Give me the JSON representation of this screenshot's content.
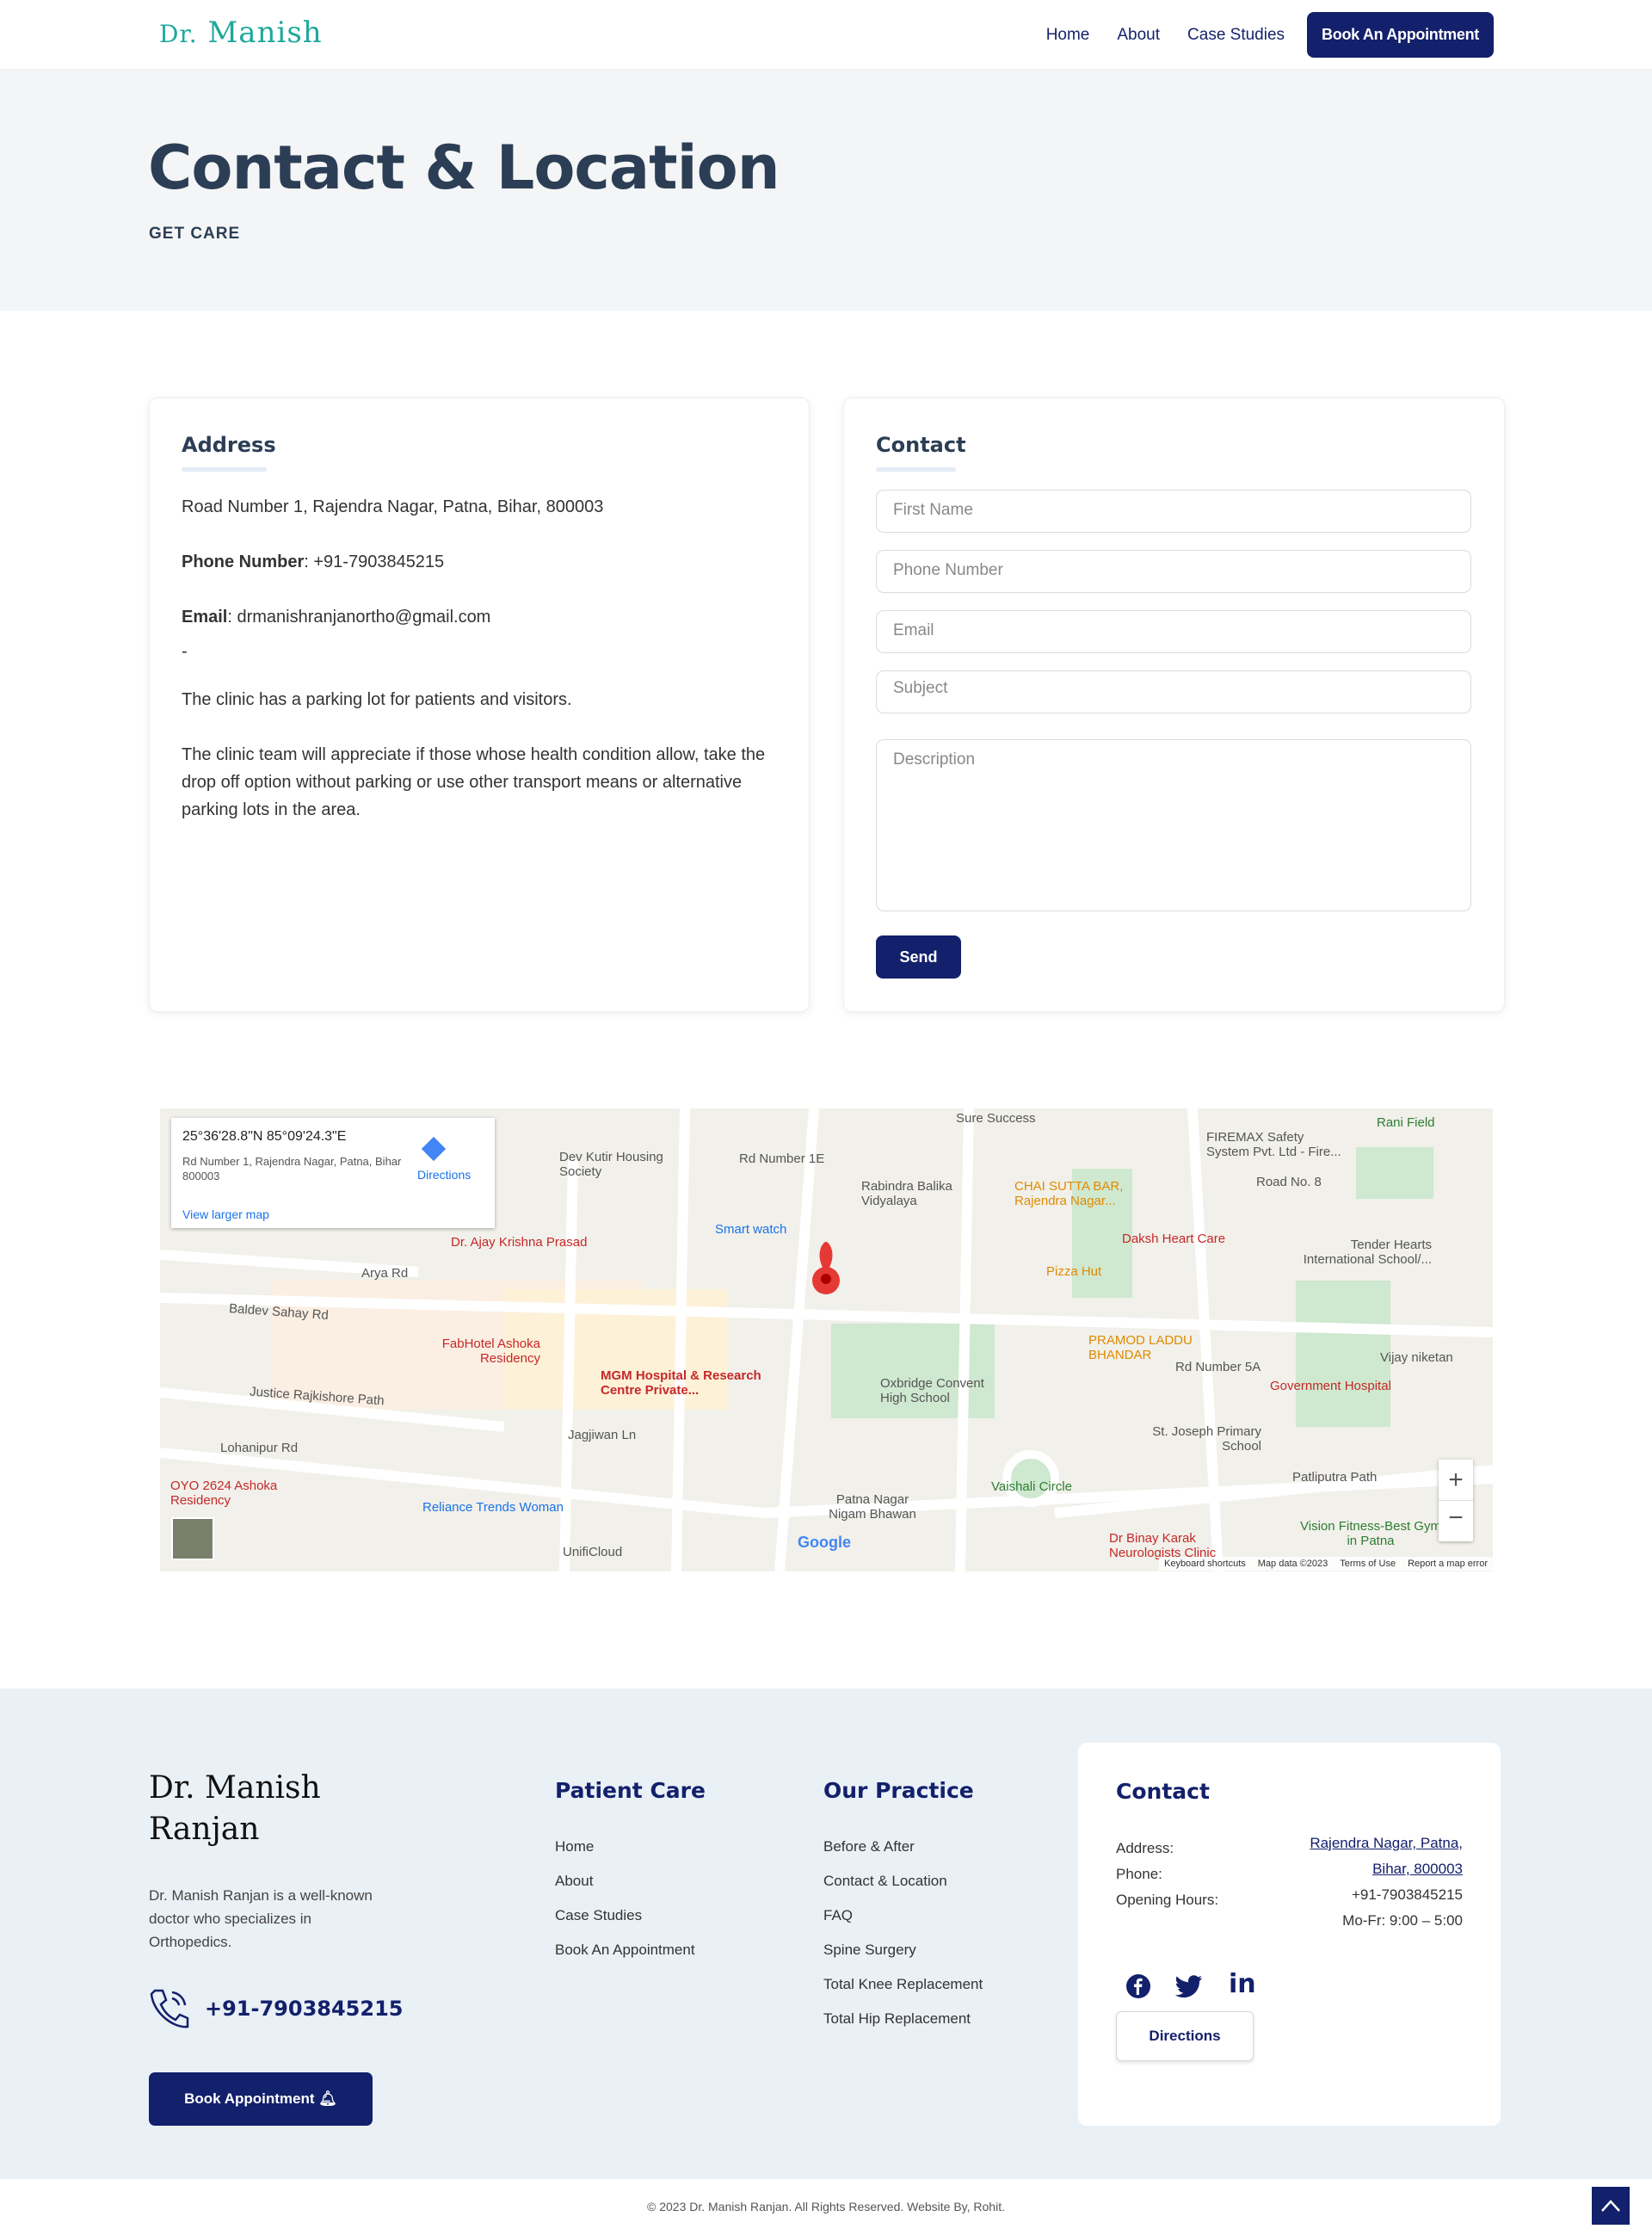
{
  "header": {
    "logo_prefix": "Dr.",
    "logo_name": "Manish",
    "nav": [
      {
        "label": "Home"
      },
      {
        "label": "About"
      },
      {
        "label": "Case Studies"
      }
    ],
    "book_label": "Book An Appointment"
  },
  "hero": {
    "title": "Contact & Location",
    "subtitle": "GET CARE"
  },
  "address_card": {
    "heading": "Address",
    "address": "Road Number 1, Rajendra Nagar, Patna, Bihar, 800003",
    "phone_label": "Phone Number",
    "phone": ": +91-7903845215",
    "email_label": "Email",
    "email": ": drmanishranjanortho@gmail.com",
    "dash": "-",
    "parking": "The clinic has a parking lot for patients and visitors.",
    "note": "The clinic team will appreciate if those whose health condition allow, take the drop off option without parking or use other transport means or alternative parking lots in the area."
  },
  "contact_card": {
    "heading": "Contact",
    "first_name": "First Name",
    "phone": "Phone Number",
    "email": "Email",
    "subject": "Subject",
    "description": "Description",
    "send": "Send"
  },
  "map": {
    "coords": "25°36'28.8\"N 85°09'24.3\"E",
    "address": "Rd Number 1, Rajendra Nagar, Patna, Bihar 800003",
    "directions": "Directions",
    "larger": "View larger map",
    "labels": [
      "Dr. Ajay Krishna Prasad",
      "FabHotel Ashoka Residency",
      "MGM Hospital & Research Centre Private...",
      "Smart watch",
      "Dev Kutir Housing Society",
      "Rabindra Balika Vidyalaya",
      "CHAI SUTTA BAR, Rajendra Nagar...",
      "Daksh Heart Care",
      "Pizza Hut",
      "PRAMOD LADDU BHANDAR",
      "Oxbridge Convent High School",
      "Government Hospital",
      "St. Joseph Primary School",
      "Vaishali Circle",
      "Reliance Trends Woman",
      "OYO 2624 Ashoka Residency",
      "Patna Nagar Nigam Bhawan",
      "Dr Binay Karak Neurologists Clinic",
      "Vision Fitness-Best Gym in Patna",
      "Tender Hearts International School/...",
      "Vijay niketan",
      "FIREMAX Safety System Pvt. Ltd - Fire...",
      "Rani Field",
      "Baldev Sahay Rd",
      "Arya Rd",
      "Justice Rajkishore Path",
      "Lohanipur Rd",
      "Jagjiwan Ln",
      "Patliputra Path",
      "UnifiCloud",
      "Sure Success",
      "Rd Number 1E",
      "Rd Number 5A",
      "Road No. 8"
    ],
    "footer": [
      "Keyboard shortcuts",
      "Map data ©2023",
      "Terms of Use",
      "Report a map error"
    ],
    "google": "Google"
  },
  "footer": {
    "brand1": "Dr. Manish",
    "brand2": "Ranjan",
    "about": "Dr. Manish Ranjan is a well-known doctor who specializes in Orthopedics.",
    "phone": "+91-7903845215",
    "book": "Book Appointment",
    "patient_care": {
      "heading": "Patient Care",
      "links": [
        "Home",
        "About",
        "Case Studies",
        "Book An Appointment"
      ]
    },
    "practice": {
      "heading": "Our Practice",
      "links": [
        "Before & After",
        "Contact & Location",
        "FAQ",
        "Spine Surgery",
        "Total Knee Replacement",
        "Total Hip Replacement"
      ]
    },
    "contact": {
      "heading": "Contact",
      "address_label": "Address:",
      "phone_label": "Phone:",
      "hours_label": "Opening Hours:",
      "address_line1": "Rajendra Nagar, Patna,",
      "address_line2": "Bihar, 800003",
      "phone": "+91-7903845215",
      "hours": "Mo-Fr: 9:00 – 5:00",
      "directions": "Directions"
    }
  },
  "copyright": "© 2023 Dr. Manish Ranjan. All Rights Reserved. Website By, Rohit.",
  "colors": {
    "brand": "#13206b",
    "logo": "#1fa89c",
    "title": "#2c3e55"
  }
}
